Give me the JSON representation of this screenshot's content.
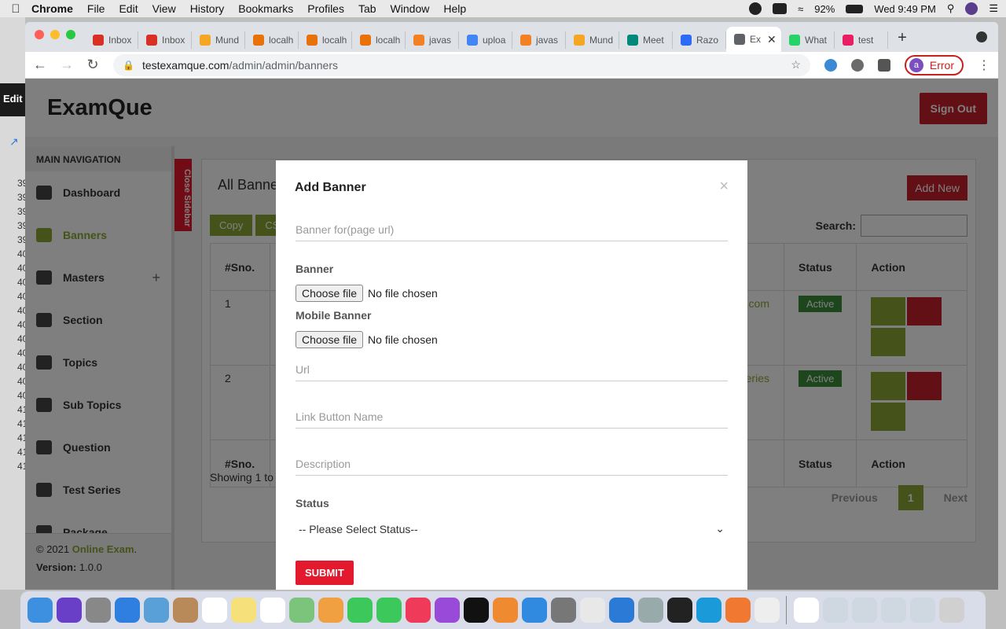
{
  "menubar": {
    "app": "Chrome",
    "items": [
      "File",
      "Edit",
      "View",
      "History",
      "Bookmarks",
      "Profiles",
      "Tab",
      "Window",
      "Help"
    ],
    "battery": "92%",
    "clock": "Wed 9:49 PM"
  },
  "background_window": {
    "left_label": "Edit",
    "numbers": [
      "39",
      "39",
      "39",
      "39",
      "39",
      "40",
      "40",
      "40",
      "40",
      "40",
      "40",
      "40",
      "40",
      "40",
      "40",
      "40",
      "41",
      "41",
      "41",
      "41",
      "41"
    ]
  },
  "tabs": [
    {
      "title": "Inbox",
      "color": "#d93025"
    },
    {
      "title": "Inbox",
      "color": "#d93025"
    },
    {
      "title": "Mund",
      "color": "#f5a623"
    },
    {
      "title": "localh",
      "color": "#e8710a"
    },
    {
      "title": "localh",
      "color": "#e8710a"
    },
    {
      "title": "localh",
      "color": "#e8710a"
    },
    {
      "title": "javas",
      "color": "#f48024"
    },
    {
      "title": "uploa",
      "color": "#4285f4"
    },
    {
      "title": "javas",
      "color": "#f48024"
    },
    {
      "title": "Mund",
      "color": "#f5a623"
    },
    {
      "title": "Meet",
      "color": "#00897b"
    },
    {
      "title": "Razo",
      "color": "#2d6bf6"
    },
    {
      "title": "Ex",
      "color": "#5f6368",
      "active": true
    },
    {
      "title": "What",
      "color": "#25d366"
    },
    {
      "title": "test",
      "color": "#e91e63"
    }
  ],
  "address": {
    "host": "testexamque.com",
    "path": "/admin/admin/banners"
  },
  "profile": {
    "initial": "a",
    "status": "Error"
  },
  "app": {
    "logo": "ExamQue",
    "signout": "Sign Out",
    "close_sidebar": "Close Sidebar",
    "nav_heading": "MAIN NAVIGATION",
    "nav": [
      {
        "label": "Dashboard",
        "icon": "home-icon"
      },
      {
        "label": "Banners",
        "icon": "image-icon",
        "active": true
      },
      {
        "label": "Masters",
        "icon": "list-icon",
        "expandable": true
      },
      {
        "label": "Section",
        "icon": "shield-icon"
      },
      {
        "label": "Topics",
        "icon": "shield-icon"
      },
      {
        "label": "Sub Topics",
        "icon": "shield-icon"
      },
      {
        "label": "Question",
        "icon": "shield-icon"
      },
      {
        "label": "Test Series",
        "icon": "shield-icon"
      },
      {
        "label": "Package",
        "icon": "grid-icon"
      }
    ],
    "footer": {
      "copyright": "© 2021",
      "brand": "Online Exam",
      "version_label": "Version:",
      "version": "1.0.0"
    }
  },
  "card": {
    "title": "All Banners",
    "add_new": "Add New",
    "buttons": [
      "Copy",
      "CSV"
    ],
    "search_label": "Search:",
    "columns": [
      "#Sno.",
      "Status",
      "Action"
    ],
    "rows": [
      {
        "sno": "1",
        "link_fragment": "e.com",
        "status": "Active"
      },
      {
        "sno": "2",
        "link_fragment": "eries",
        "status": "Active"
      }
    ],
    "showing": "Showing 1 to",
    "pager": {
      "previous": "Previous",
      "current": "1",
      "next": "Next"
    }
  },
  "modal": {
    "title": "Add Banner",
    "close": "×",
    "banner_for_placeholder": "Banner for(page url)",
    "banner_label": "Banner",
    "mobile_banner_label": "Mobile Banner",
    "file_button": "Choose file",
    "file_status": "No file chosen",
    "url_placeholder": "Url",
    "link_button_placeholder": "Link Button Name",
    "description_placeholder": "Description",
    "status_label": "Status",
    "status_selected": "-- Please Select Status--",
    "submit": "SUBMIT"
  },
  "colors": {
    "accent_green": "#8aa637",
    "accent_red": "#c41e2a",
    "submit_red": "#e3192d"
  },
  "dock": [
    "finder",
    "siri",
    "launchpad",
    "safari",
    "preview",
    "contacts",
    "calendar",
    "notes",
    "reminders",
    "maps",
    "photos",
    "messages",
    "facetime",
    "music",
    "podcasts",
    "tv",
    "books",
    "appstore",
    "system-preferences",
    "chrome",
    "vscode",
    "utility",
    "terminal",
    "skype",
    "firefox",
    "textedit",
    "document",
    "file1",
    "file2",
    "file3",
    "file4",
    "trash"
  ]
}
